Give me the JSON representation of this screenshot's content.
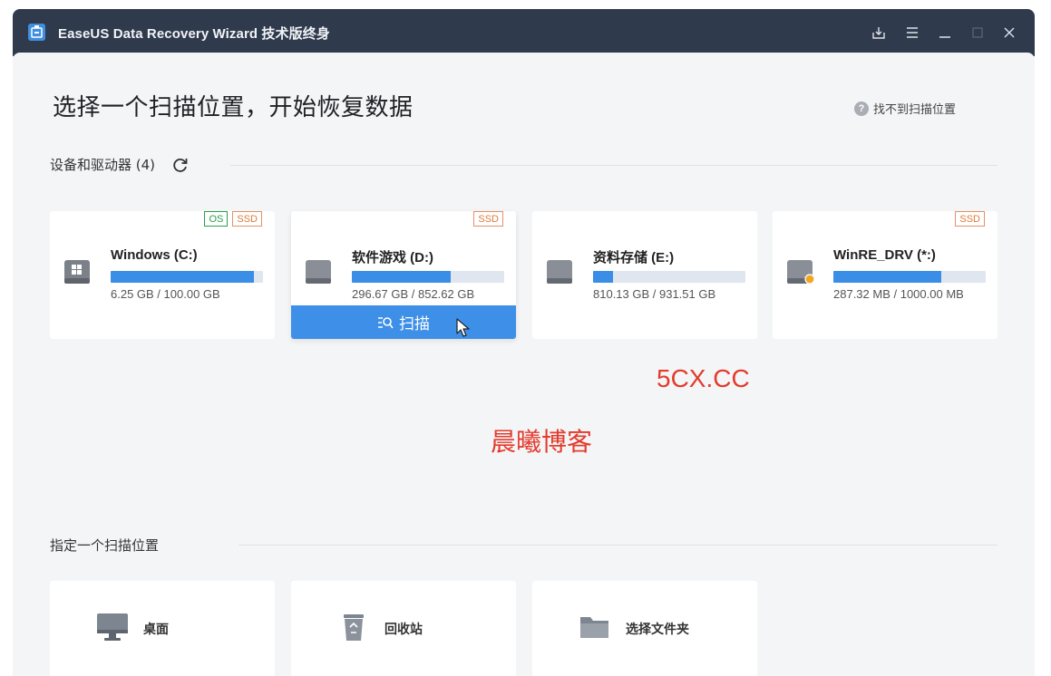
{
  "titlebar": {
    "app_name": "EaseUS Data Recovery Wizard 技术版终身",
    "buttons": [
      "download-icon",
      "menu-icon",
      "minimize-icon",
      "maximize-icon",
      "close-icon"
    ]
  },
  "main": {
    "title": "选择一个扫描位置，开始恢复数据",
    "help_link": "找不到扫描位置",
    "help_icon_glyph": "?"
  },
  "devices_section": {
    "label": "设备和驱动器 (4)",
    "drives": [
      {
        "name": "Windows (C:)",
        "size": "6.25 GB / 100.00 GB",
        "used_fraction": 0.94,
        "badges": [
          "OS",
          "SSD"
        ],
        "icon": "windows-drive-icon"
      },
      {
        "name": "软件游戏 (D:)",
        "size": "296.67 GB / 852.62 GB",
        "used_fraction": 0.65,
        "badges": [
          "SSD"
        ],
        "icon": "hard-drive-icon",
        "scan_label": "扫描"
      },
      {
        "name": "资料存储 (E:)",
        "size": "810.13 GB / 931.51 GB",
        "used_fraction": 0.13,
        "badges": [],
        "icon": "hard-drive-icon"
      },
      {
        "name": "WinRE_DRV (*:)",
        "size": "287.32 MB / 1000.00 MB",
        "used_fraction": 0.71,
        "badges": [
          "SSD"
        ],
        "icon": "recovery-drive-icon"
      }
    ]
  },
  "locations_section": {
    "label": "指定一个扫描位置",
    "items": [
      {
        "label": "桌面",
        "icon": "desktop-icon"
      },
      {
        "label": "回收站",
        "icon": "recycle-bin-icon"
      },
      {
        "label": "选择文件夹",
        "icon": "folder-icon"
      }
    ]
  },
  "watermark": {
    "site": "5CX.CC",
    "blog": "晨曦博客"
  },
  "colors": {
    "titlebar": "#2f3a4c",
    "accent": "#3d8fe8",
    "bar_fill": "#3a8ee6",
    "os_badge": "#2aa04a",
    "ssd_badge": "#e07b3b",
    "watermark": "#e33b2c"
  }
}
